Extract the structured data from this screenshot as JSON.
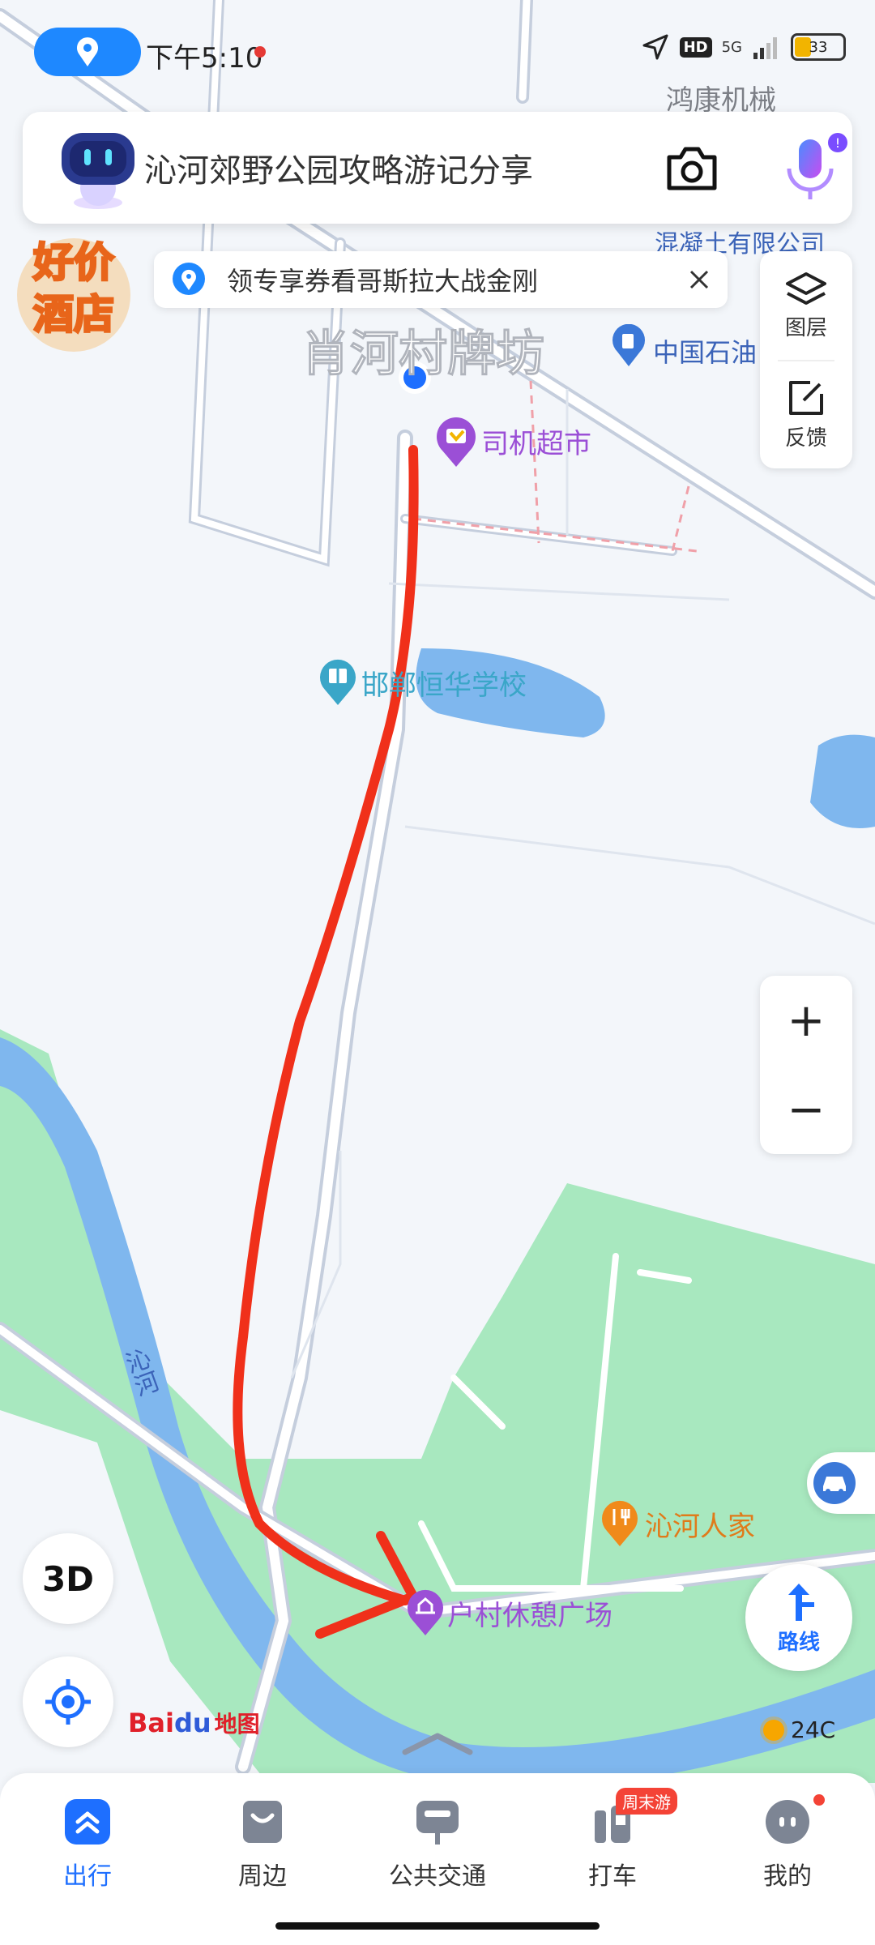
{
  "status_bar": {
    "time": "下午5:10",
    "hd": "HD",
    "network": "5G",
    "battery": "33"
  },
  "search": {
    "text": "沁河郊野公园攻略游记分享"
  },
  "promo": {
    "line1": "好价",
    "line2": "酒店"
  },
  "notice": {
    "text": "领专享券看哥斯拉大战金刚"
  },
  "side_panel": {
    "layers_label": "图层",
    "feedback_label": "反馈"
  },
  "zoom": {
    "in": "+",
    "out": "−"
  },
  "controls": {
    "three_d": "3D",
    "route_label": "路线"
  },
  "brand": {
    "part1": "Bai",
    "part2": "du",
    "part3": "地图"
  },
  "weather": {
    "temp": "24C"
  },
  "map_labels": {
    "hongkang": "鸿康机械",
    "hunningtu": "混凝土有限公司",
    "sinopec": "中国石油",
    "xiaohe_arch": "肖河村牌坊",
    "siji": "司机超市",
    "school": "邯郸恒华学校",
    "river": "沁河",
    "qinhe_renjia": "沁河人家",
    "xiuxi": "户村休憩广场"
  },
  "bottom_nav": {
    "items": [
      {
        "label": "出行",
        "active": true
      },
      {
        "label": "周边",
        "active": false
      },
      {
        "label": "公共交通",
        "active": false
      },
      {
        "label": "打车",
        "active": false,
        "badge": "周末游"
      },
      {
        "label": "我的",
        "active": false
      }
    ]
  },
  "colors": {
    "accent": "#1e6fff",
    "park": "#a8e8bf",
    "river": "#7fb7ee",
    "route_marker": "#f0301a",
    "poi_purple": "#9b4fd6",
    "poi_teal": "#3aa6c8"
  }
}
